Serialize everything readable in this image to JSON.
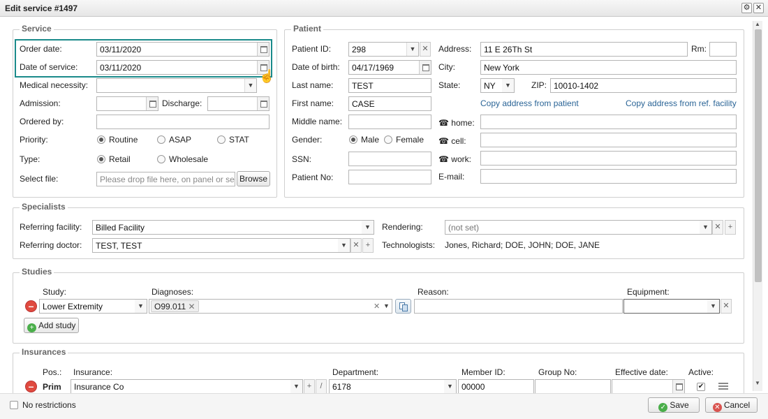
{
  "window": {
    "title": "Edit service #1497"
  },
  "service": {
    "legend": "Service",
    "order_date_label": "Order date:",
    "order_date": "03/11/2020",
    "date_of_service_label": "Date of service:",
    "date_of_service": "03/11/2020",
    "medical_necessity_label": "Medical necessity:",
    "admission_label": "Admission:",
    "discharge_label": "Discharge:",
    "ordered_by_label": "Ordered by:",
    "priority_label": "Priority:",
    "priority_options": [
      "Routine",
      "ASAP",
      "STAT"
    ],
    "priority_selected": "Routine",
    "type_label": "Type:",
    "type_options": [
      "Retail",
      "Wholesale"
    ],
    "type_selected": "Retail",
    "select_file_label": "Select file:",
    "file_placeholder": "Please drop file here, on panel or se",
    "browse_label": "Browse"
  },
  "patient": {
    "legend": "Patient",
    "patient_id_label": "Patient ID:",
    "patient_id": "298",
    "dob_label": "Date of birth:",
    "dob": "04/17/1969",
    "last_name_label": "Last name:",
    "last_name": "TEST",
    "first_name_label": "First name:",
    "first_name": "CASE",
    "middle_name_label": "Middle name:",
    "gender_label": "Gender:",
    "gender_options": [
      "Male",
      "Female"
    ],
    "gender_selected": "Male",
    "ssn_label": "SSN:",
    "patient_no_label": "Patient No:",
    "address_label": "Address:",
    "address": "11 E 26Th St",
    "rm_label": "Rm:",
    "city_label": "City:",
    "city": "New York",
    "state_label": "State:",
    "state": "NY",
    "zip_label": "ZIP:",
    "zip": "10010-1402",
    "copy_from_patient": "Copy address from patient",
    "copy_from_facility": "Copy address from ref. facility",
    "home_label": "home:",
    "cell_label": "cell:",
    "work_label": "work:",
    "email_label": "E-mail:"
  },
  "specialists": {
    "legend": "Specialists",
    "referring_facility_label": "Referring facility:",
    "referring_facility": "Billed Facility",
    "referring_doctor_label": "Referring doctor:",
    "referring_doctor": "TEST, TEST",
    "rendering_label": "Rendering:",
    "rendering": "(not set)",
    "technologists_label": "Technologists:",
    "technologists": "Jones, Richard; DOE, JOHN; DOE, JANE"
  },
  "studies": {
    "legend": "Studies",
    "study_header": "Study:",
    "diagnoses_header": "Diagnoses:",
    "reason_header": "Reason:",
    "equipment_header": "Equipment:",
    "study": "Lower Extremity",
    "diagnosis_tag": "O99.011",
    "add_study_label": "Add study"
  },
  "insurances": {
    "legend": "Insurances",
    "pos_header": "Pos.:",
    "insurance_header": "Insurance:",
    "department_header": "Department:",
    "member_id_header": "Member ID:",
    "group_no_header": "Group No:",
    "effective_date_header": "Effective date:",
    "active_header": "Active:",
    "pos": "Prim",
    "insurance": "Insurance Co",
    "department": "6178",
    "member_id": "00000"
  },
  "footer": {
    "no_restrictions": "No restrictions",
    "save": "Save",
    "cancel": "Cancel"
  },
  "colors": {
    "highlight": "#1a8a8a",
    "link": "#2a6496"
  }
}
